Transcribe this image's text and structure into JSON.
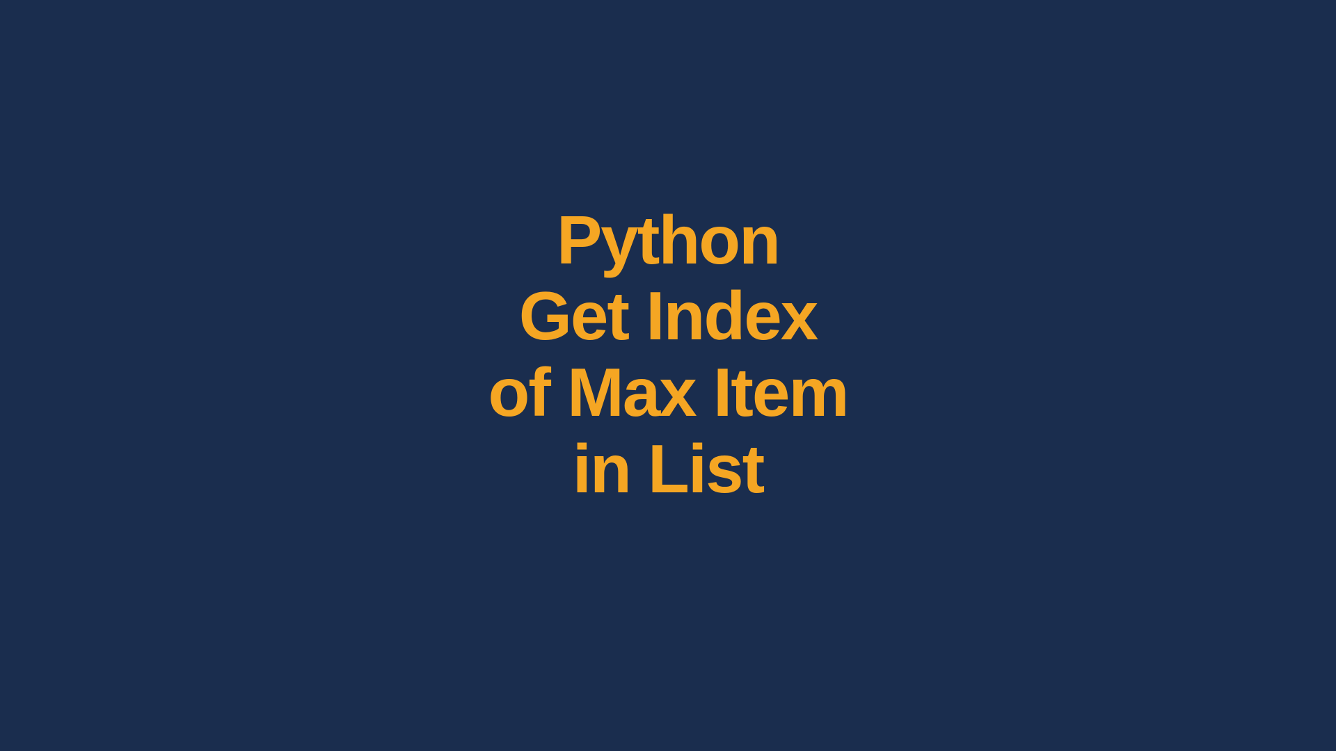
{
  "title": {
    "line1": "Python",
    "line2": "Get Index",
    "line3": "of Max Item",
    "line4": "in List"
  },
  "colors": {
    "background": "#1a2d4e",
    "text": "#f5a623"
  }
}
